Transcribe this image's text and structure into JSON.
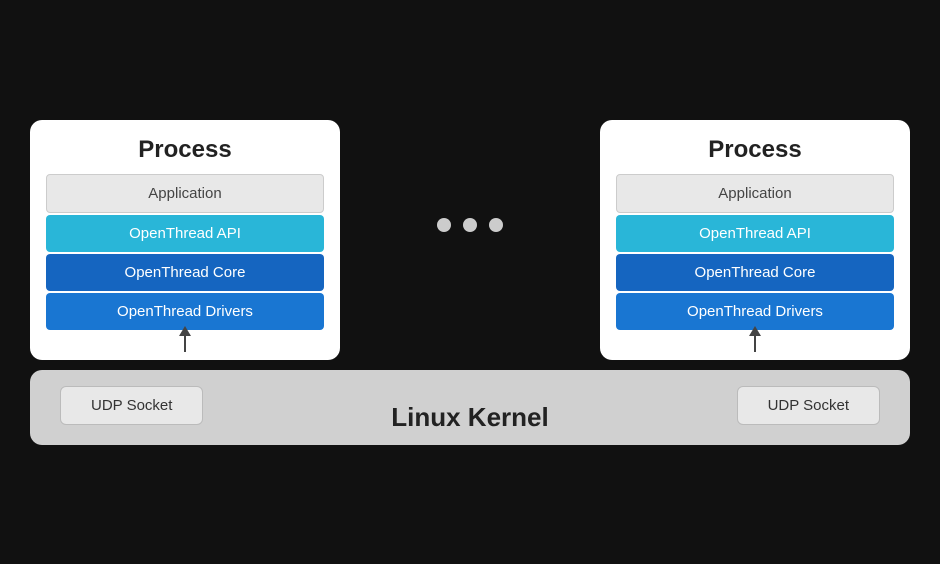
{
  "processes": [
    {
      "title": "Process",
      "layers": [
        {
          "label": "Application",
          "type": "application"
        },
        {
          "label": "OpenThread API",
          "type": "api"
        },
        {
          "label": "OpenThread Core",
          "type": "core"
        },
        {
          "label": "OpenThread Drivers",
          "type": "drivers"
        }
      ]
    },
    {
      "title": "Process",
      "layers": [
        {
          "label": "Application",
          "type": "application"
        },
        {
          "label": "OpenThread API",
          "type": "api"
        },
        {
          "label": "OpenThread Core",
          "type": "core"
        },
        {
          "label": "OpenThread Drivers",
          "type": "drivers"
        }
      ]
    }
  ],
  "ellipsis": {
    "dots": [
      "•",
      "•",
      "•"
    ]
  },
  "kernel": {
    "title": "Linux Kernel",
    "udp_sockets": [
      "UDP Socket",
      "UDP Socket"
    ]
  }
}
